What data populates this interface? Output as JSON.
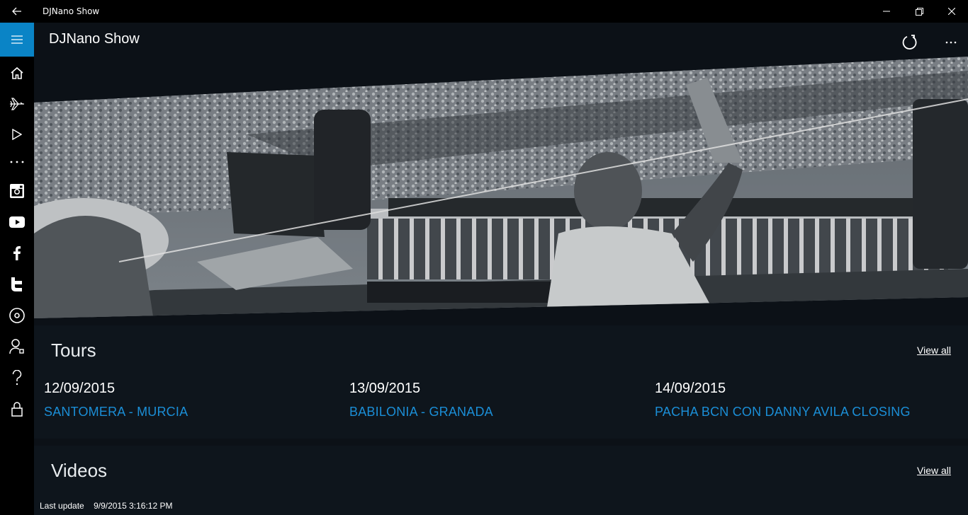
{
  "window": {
    "title": "DJNano Show"
  },
  "header": {
    "title": "DJNano Show"
  },
  "rail": {
    "icons": [
      "menu-icon",
      "home-icon",
      "airplane-icon",
      "play-icon",
      "more-icon",
      "instagram-icon",
      "youtube-icon",
      "facebook-icon",
      "twitter-icon",
      "disc-icon",
      "user-icon",
      "help-icon",
      "lock-icon"
    ]
  },
  "colors": {
    "accent": "#0a84c6",
    "link": "#1b8ed6",
    "panel": "#0e151c",
    "background": "#0c1117"
  },
  "tours": {
    "title": "Tours",
    "view_all": "View all",
    "items": [
      {
        "date": "12/09/2015",
        "place": "SANTOMERA - MURCIA"
      },
      {
        "date": "13/09/2015",
        "place": "BABILONIA - GRANADA"
      },
      {
        "date": "14/09/2015",
        "place": "PACHA BCN CON DANNY AVILA CLOSING"
      }
    ]
  },
  "videos": {
    "title": "Videos",
    "view_all": "View all"
  },
  "status": {
    "label": "Last update",
    "value": "9/9/2015 3:16:12 PM"
  }
}
